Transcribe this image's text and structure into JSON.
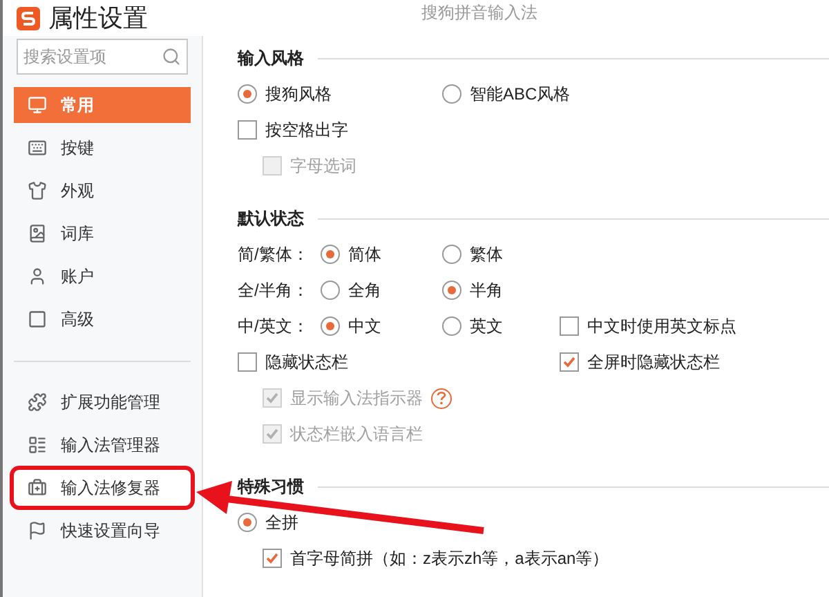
{
  "window": {
    "title": "属性设置",
    "app_name": "搜狗拼音输入法"
  },
  "sidebar": {
    "search": {
      "placeholder": "搜索设置项"
    },
    "items": [
      {
        "label": "常用",
        "selected": true,
        "highlighted": false
      },
      {
        "label": "按键",
        "selected": false,
        "highlighted": false
      },
      {
        "label": "外观",
        "selected": false,
        "highlighted": false
      },
      {
        "label": "词库",
        "selected": false,
        "highlighted": false
      },
      {
        "label": "账户",
        "selected": false,
        "highlighted": false
      },
      {
        "label": "高级",
        "selected": false,
        "highlighted": false
      }
    ],
    "tools": [
      {
        "label": "扩展功能管理",
        "highlighted": false
      },
      {
        "label": "输入法管理器",
        "highlighted": false
      },
      {
        "label": "输入法修复器",
        "highlighted": true
      },
      {
        "label": "快速设置向导",
        "highlighted": false
      }
    ]
  },
  "sections": [
    {
      "title": "输入风格",
      "rows": [
        {
          "controls": [
            {
              "kind": "radio",
              "label": "搜狗风格",
              "selected": true,
              "disabled": false,
              "help": false
            },
            {
              "kind": "radio",
              "label": "智能ABC风格",
              "selected": false,
              "disabled": false,
              "help": false
            }
          ]
        },
        {
          "controls": [
            {
              "kind": "checkbox",
              "label": "按空格出字",
              "checked": false,
              "disabled": false,
              "help": false
            }
          ],
          "children": [
            {
              "controls": [
                {
                  "kind": "checkbox",
                  "label": "字母选词",
                  "checked": false,
                  "disabled": true,
                  "help": false
                }
              ]
            }
          ]
        }
      ]
    },
    {
      "title": "默认状态",
      "rows": [
        {
          "label": "简/繁体：",
          "controls": [
            {
              "kind": "radio",
              "label": "简体",
              "selected": true,
              "disabled": false,
              "help": false
            },
            {
              "kind": "radio",
              "label": "繁体",
              "selected": false,
              "disabled": false,
              "help": false
            }
          ]
        },
        {
          "label": "全/半角：",
          "controls": [
            {
              "kind": "radio",
              "label": "全角",
              "selected": false,
              "disabled": false,
              "help": false
            },
            {
              "kind": "radio",
              "label": "半角",
              "selected": true,
              "disabled": false,
              "help": false
            }
          ]
        },
        {
          "label": "中/英文：",
          "controls": [
            {
              "kind": "radio",
              "label": "中文",
              "selected": true,
              "disabled": false,
              "help": false
            },
            {
              "kind": "radio",
              "label": "英文",
              "selected": false,
              "disabled": false,
              "help": false
            },
            {
              "kind": "checkbox",
              "label": "中文时使用英文标点",
              "checked": false,
              "disabled": false,
              "help": false
            }
          ]
        },
        {
          "controls": [
            {
              "kind": "checkbox",
              "label": "隐藏状态栏",
              "checked": false,
              "disabled": false,
              "help": false
            },
            {
              "kind": "checkbox",
              "label": "全屏时隐藏状态栏",
              "checked": true,
              "disabled": false,
              "help": false
            }
          ],
          "children": [
            {
              "controls": [
                {
                  "kind": "checkbox",
                  "label": "显示输入法指示器",
                  "checked": true,
                  "disabled": true,
                  "help": true
                }
              ]
            },
            {
              "controls": [
                {
                  "kind": "checkbox",
                  "label": "状态栏嵌入语言栏",
                  "checked": true,
                  "disabled": true,
                  "help": false
                }
              ]
            }
          ]
        }
      ]
    },
    {
      "title": "特殊习惯",
      "rows": [
        {
          "controls": [
            {
              "kind": "radio",
              "label": "全拼",
              "selected": true,
              "disabled": false,
              "help": false
            }
          ],
          "children": [
            {
              "controls": [
                {
                  "kind": "checkbox",
                  "label": "首字母简拼（如：z表示zh等，a表示an等）",
                  "checked": true,
                  "disabled": false,
                  "help": false
                }
              ]
            }
          ]
        }
      ]
    }
  ]
}
